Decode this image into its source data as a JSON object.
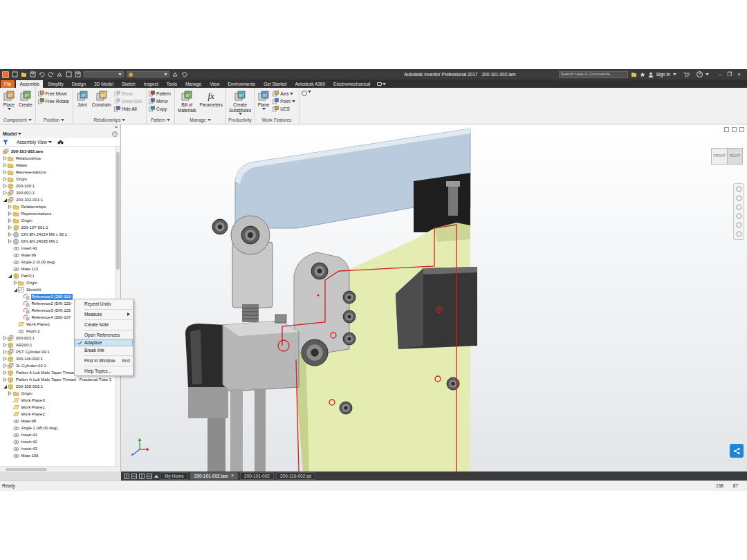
{
  "window": {
    "app": "Autodesk Inventor Professional 2017",
    "document": "200-101-002.iam",
    "controls": [
      "–",
      "❐",
      "×"
    ]
  },
  "search": {
    "placeholder": "Search Help & Commands..."
  },
  "account": {
    "sign_in": "Sign In",
    "help": "?"
  },
  "ribbon_tabs": [
    {
      "label": "File",
      "selected": false,
      "kind": "application"
    },
    {
      "label": "Assemble",
      "selected": true,
      "kind": "tab"
    },
    {
      "label": "Simplify",
      "selected": false,
      "kind": "tab"
    },
    {
      "label": "Design",
      "selected": false,
      "kind": "tab"
    },
    {
      "label": "3D Model",
      "selected": false,
      "kind": "tab"
    },
    {
      "label": "Sketch",
      "selected": false,
      "kind": "tab"
    },
    {
      "label": "Inspect",
      "selected": false,
      "kind": "tab"
    },
    {
      "label": "Tools",
      "selected": false,
      "kind": "tab"
    },
    {
      "label": "Manage",
      "selected": false,
      "kind": "tab"
    },
    {
      "label": "View",
      "selected": false,
      "kind": "tab"
    },
    {
      "label": "Environments",
      "selected": false,
      "kind": "tab"
    },
    {
      "label": "Get Started",
      "selected": false,
      "kind": "tab"
    },
    {
      "label": "Autodesk A360",
      "selected": false,
      "kind": "tab"
    },
    {
      "label": "Electromechanical",
      "selected": false,
      "kind": "tab"
    }
  ],
  "ribbon_panels": [
    {
      "title": "Component",
      "dropdown": true,
      "large": [
        {
          "lines": [
            "Place"
          ],
          "glyph": "",
          "dropdown": true
        },
        {
          "lines": [
            "Create"
          ],
          "glyph": "",
          "dropdown": false
        }
      ],
      "small": []
    },
    {
      "title": "Position",
      "dropdown": true,
      "large": [],
      "small": [
        {
          "label": "Free Move",
          "disabled": false,
          "dropdown": false
        },
        {
          "label": "Free Rotate",
          "disabled": false,
          "dropdown": false
        }
      ]
    },
    {
      "title": "Relationships",
      "dropdown": true,
      "large": [
        {
          "lines": [
            "Joint"
          ],
          "glyph": "",
          "dropdown": false
        },
        {
          "lines": [
            "Constrain"
          ],
          "glyph": "",
          "dropdown": false
        }
      ],
      "small": [
        {
          "label": "Show",
          "disabled": true,
          "dropdown": false
        },
        {
          "label": "Show Sick",
          "disabled": true,
          "dropdown": false
        },
        {
          "label": "Hide All",
          "disabled": false,
          "dropdown": false
        }
      ]
    },
    {
      "title": "Pattern",
      "dropdown": true,
      "large": [],
      "small": [
        {
          "label": "Pattern",
          "disabled": false,
          "dropdown": false
        },
        {
          "label": "Mirror",
          "disabled": false,
          "dropdown": false
        },
        {
          "label": "Copy",
          "disabled": false,
          "dropdown": false
        }
      ]
    },
    {
      "title": "Manage",
      "dropdown": true,
      "large": [
        {
          "lines": [
            "Bill of",
            "Materials"
          ],
          "glyph": "",
          "dropdown": false
        },
        {
          "lines": [
            "Parameters"
          ],
          "glyph": "fx",
          "dropdown": false
        }
      ],
      "small": []
    },
    {
      "title": "Productivity",
      "dropdown": false,
      "large": [
        {
          "lines": [
            "Create",
            "Substitutes"
          ],
          "glyph": "",
          "dropdown": true
        }
      ],
      "small": []
    },
    {
      "title": "Work Features",
      "dropdown": false,
      "large": [
        {
          "lines": [
            "Plane"
          ],
          "glyph": "",
          "dropdown": true
        }
      ],
      "small": [
        {
          "label": "Axis",
          "disabled": false,
          "dropdown": true
        },
        {
          "label": "Point",
          "disabled": false,
          "dropdown": true
        },
        {
          "label": "UCS",
          "disabled": false,
          "dropdown": false
        }
      ]
    }
  ],
  "browser": {
    "title": "Model",
    "title_dropdown": true,
    "help": "?",
    "close": "×",
    "view": "Assembly View",
    "view_dropdown": true
  },
  "tree": [
    {
      "label": "200-101-002.iam",
      "depth": 0,
      "kind": "assembly",
      "expandable": false,
      "expanded": true,
      "selected": false
    },
    {
      "label": "Relationships",
      "depth": 1,
      "kind": "folder",
      "expandable": true,
      "expanded": false,
      "selected": false
    },
    {
      "label": "Mates",
      "depth": 1,
      "kind": "folder",
      "expandable": true,
      "expanded": false,
      "selected": false
    },
    {
      "label": "Representations",
      "depth": 1,
      "kind": "folder",
      "expandable": true,
      "expanded": false,
      "selected": false
    },
    {
      "label": "Origin",
      "depth": 1,
      "kind": "folder",
      "expandable": true,
      "expanded": false,
      "selected": false
    },
    {
      "label": "200-106:1",
      "depth": 1,
      "kind": "part",
      "expandable": true,
      "expanded": false,
      "selected": false
    },
    {
      "label": "300-001:1",
      "depth": 1,
      "kind": "assembly",
      "expandable": true,
      "expanded": false,
      "selected": false
    },
    {
      "label": "200-102-001:1",
      "depth": 1,
      "kind": "assembly",
      "expandable": true,
      "expanded": true,
      "selected": false
    },
    {
      "label": "Relationships",
      "depth": 2,
      "kind": "folder",
      "expandable": true,
      "expanded": false,
      "selected": false
    },
    {
      "label": "Representations",
      "depth": 2,
      "kind": "folder",
      "expandable": true,
      "expanded": false,
      "selected": false
    },
    {
      "label": "Origin",
      "depth": 2,
      "kind": "folder",
      "expandable": true,
      "expanded": false,
      "selected": false
    },
    {
      "label": "200-107-001:1",
      "depth": 2,
      "kind": "part",
      "expandable": true,
      "expanded": false,
      "selected": false
    },
    {
      "label": "DIN EN 24014 M6 x 30:1",
      "depth": 2,
      "kind": "fastener",
      "expandable": true,
      "expanded": false,
      "selected": false
    },
    {
      "label": "DIN EN 24035 M6:1",
      "depth": 2,
      "kind": "fastener",
      "expandable": true,
      "expanded": false,
      "selected": false
    },
    {
      "label": "Insert:41",
      "depth": 2,
      "kind": "constraint",
      "expandable": false,
      "expanded": false,
      "selected": false
    },
    {
      "label": "Mate:99",
      "depth": 2,
      "kind": "constraint",
      "expandable": false,
      "expanded": false,
      "selected": false
    },
    {
      "label": "Angle:2 (0.00 deg)",
      "depth": 2,
      "kind": "constraint",
      "expandable": false,
      "expanded": false,
      "selected": false
    },
    {
      "label": "Mate:113",
      "depth": 2,
      "kind": "constraint",
      "expandable": false,
      "expanded": false,
      "selected": false
    },
    {
      "label": "Part3:1",
      "depth": 2,
      "kind": "part",
      "expandable": true,
      "expanded": true,
      "selected": false
    },
    {
      "label": "Origin",
      "depth": 3,
      "kind": "folder",
      "expandable": true,
      "expanded": false,
      "selected": false
    },
    {
      "label": "Sketch1",
      "depth": 3,
      "kind": "sketch",
      "expandable": true,
      "expanded": true,
      "selected": false
    },
    {
      "label": "Reference1 (200-116-",
      "depth": 4,
      "kind": "reference",
      "expandable": false,
      "expanded": false,
      "selected": true
    },
    {
      "label": "Reference2 (DIN 125-",
      "depth": 4,
      "kind": "reference",
      "expandable": false,
      "expanded": false,
      "selected": false
    },
    {
      "label": "Reference3 (DIN 125",
      "depth": 4,
      "kind": "reference",
      "expandable": false,
      "expanded": false,
      "selected": false
    },
    {
      "label": "Reference4 (200-107",
      "depth": 4,
      "kind": "reference",
      "expandable": false,
      "expanded": false,
      "selected": false
    },
    {
      "label": "Work Plane1",
      "depth": 3,
      "kind": "workplane",
      "expandable": false,
      "expanded": false,
      "selected": false
    },
    {
      "label": "Flush:2",
      "depth": 3,
      "kind": "constraint",
      "expandable": false,
      "expanded": false,
      "selected": false
    },
    {
      "label": "000-003:1",
      "depth": 1,
      "kind": "assembly",
      "expandable": true,
      "expanded": false,
      "selected": false
    },
    {
      "label": "AR200:1",
      "depth": 1,
      "kind": "part",
      "expandable": true,
      "expanded": false,
      "selected": false
    },
    {
      "label": "PST Cylinder-04:1",
      "depth": 1,
      "kind": "assembly",
      "expandable": true,
      "expanded": false,
      "selected": false
    },
    {
      "label": "200-116-002:1",
      "depth": 1,
      "kind": "part",
      "expandable": true,
      "expanded": false,
      "selected": false
    },
    {
      "label": "3L Cylinder-02:1",
      "depth": 1,
      "kind": "assembly",
      "expandable": true,
      "expanded": false,
      "selected": false
    },
    {
      "label": "Parker A-Lok Male Taper Thread - Fractional Tube 1",
      "depth": 1,
      "kind": "part",
      "expandable": true,
      "expanded": false,
      "selected": false
    },
    {
      "label": "Parker A-Lok Male Taper Thread - Fractional Tube 1",
      "depth": 1,
      "kind": "part",
      "expandable": true,
      "expanded": false,
      "selected": false
    },
    {
      "label": "200-105-001:1",
      "depth": 1,
      "kind": "part",
      "expandable": true,
      "expanded": true,
      "selected": false
    },
    {
      "label": "Origin",
      "depth": 2,
      "kind": "folder",
      "expandable": true,
      "expanded": false,
      "selected": false
    },
    {
      "label": "Work Plane3",
      "depth": 2,
      "kind": "workplane",
      "expandable": false,
      "expanded": false,
      "selected": false
    },
    {
      "label": "Work Plane1",
      "depth": 2,
      "kind": "workplane",
      "expandable": false,
      "expanded": false,
      "selected": false
    },
    {
      "label": "Work Plane2",
      "depth": 2,
      "kind": "workplane",
      "expandable": false,
      "expanded": false,
      "selected": false
    },
    {
      "label": "Mate:98",
      "depth": 2,
      "kind": "constraint",
      "expandable": false,
      "expanded": false,
      "selected": false
    },
    {
      "label": "Angle:1 (45.00 deg)",
      "depth": 2,
      "kind": "constraint",
      "expandable": false,
      "expanded": false,
      "selected": false
    },
    {
      "label": "Insert:41",
      "depth": 2,
      "kind": "constraint",
      "expandable": false,
      "expanded": false,
      "selected": false
    },
    {
      "label": "Insert:42",
      "depth": 2,
      "kind": "constraint",
      "expandable": false,
      "expanded": false,
      "selected": false
    },
    {
      "label": "Insert:43",
      "depth": 2,
      "kind": "constraint",
      "expandable": false,
      "expanded": false,
      "selected": false
    },
    {
      "label": "Mate:106",
      "depth": 2,
      "kind": "constraint",
      "expandable": false,
      "expanded": false,
      "selected": false
    }
  ],
  "context_menu": [
    {
      "label": "Repeat Undo",
      "shortcut": "",
      "submenu": false,
      "checked": false,
      "selected": false,
      "divider_after": true
    },
    {
      "label": "Measure",
      "shortcut": "",
      "submenu": true,
      "checked": false,
      "selected": false,
      "divider_after": true
    },
    {
      "label": "Create Note",
      "shortcut": "",
      "submenu": false,
      "checked": false,
      "selected": false,
      "divider_after": true
    },
    {
      "label": "Open References",
      "shortcut": "",
      "submenu": false,
      "checked": false,
      "selected": false,
      "divider_after": false
    },
    {
      "label": "Adaptive",
      "shortcut": "",
      "submenu": false,
      "checked": true,
      "selected": true,
      "divider_after": false
    },
    {
      "label": "Break link",
      "shortcut": "",
      "submenu": false,
      "checked": false,
      "selected": false,
      "divider_after": true
    },
    {
      "label": "Find in Window",
      "shortcut": "End",
      "submenu": false,
      "checked": false,
      "selected": false,
      "divider_after": true
    },
    {
      "label": "Help Topics...",
      "shortcut": "",
      "submenu": false,
      "checked": false,
      "selected": false,
      "divider_after": false
    }
  ],
  "view_cube": {
    "front": "FRONT",
    "right": "RIGHT"
  },
  "document_tabs": {
    "close": "×",
    "items": [
      {
        "label": "My Home",
        "selected": false,
        "closable": false
      },
      {
        "label": "200-101-002.iam",
        "selected": true,
        "closable": true
      },
      {
        "label": "200-101-002",
        "selected": false,
        "closable": false
      },
      {
        "label": "200-116-002.ipt",
        "selected": false,
        "closable": false
      }
    ]
  },
  "status_bar": {
    "message": "Ready",
    "x": "138",
    "y": "87"
  }
}
